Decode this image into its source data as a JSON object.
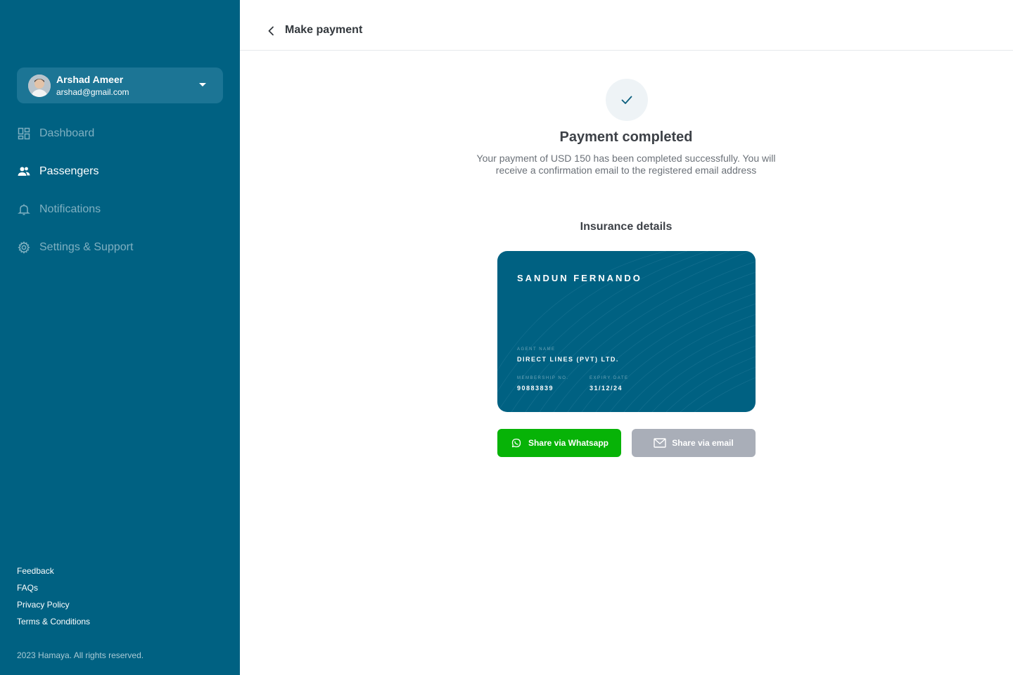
{
  "sidebar": {
    "user": {
      "name": "Arshad Ameer",
      "email": "arshad@gmail.com"
    },
    "nav": [
      {
        "label": "Dashboard",
        "icon": "dashboard-icon",
        "active": false
      },
      {
        "label": "Passengers",
        "icon": "passengers-icon",
        "active": true
      },
      {
        "label": "Notifications",
        "icon": "bell-icon",
        "active": false
      },
      {
        "label": "Settings & Support",
        "icon": "gear-icon",
        "active": false
      }
    ],
    "footer_links": [
      "Feedback",
      "FAQs",
      "Privacy Policy",
      "Terms & Conditions"
    ],
    "copyright": "2023 Hamaya. All rights reserved."
  },
  "header": {
    "title": "Make payment"
  },
  "main": {
    "status_title": "Payment completed",
    "status_description": "Your payment of USD 150 has been completed successfully. You will receive a confirmation email to the registered email address",
    "section_title": "Insurance details",
    "card": {
      "holder_name": "SANDUN FERNANDO",
      "agent_label": "AGENT NAME",
      "agent_value": "DIRECT LINES (PVT) LTD.",
      "membership_label": "MEMBERSHIP NO.",
      "membership_value": "90883839",
      "expiry_label": "EXPIRY DATE",
      "expiry_value": "31/12/24"
    },
    "actions": {
      "whatsapp_label": "Share via Whatsapp",
      "email_label": "Share via email"
    }
  },
  "colors": {
    "sidebar_bg": "#006182",
    "accent_green": "#07B307",
    "disabled_grey": "#A9AEB8"
  }
}
